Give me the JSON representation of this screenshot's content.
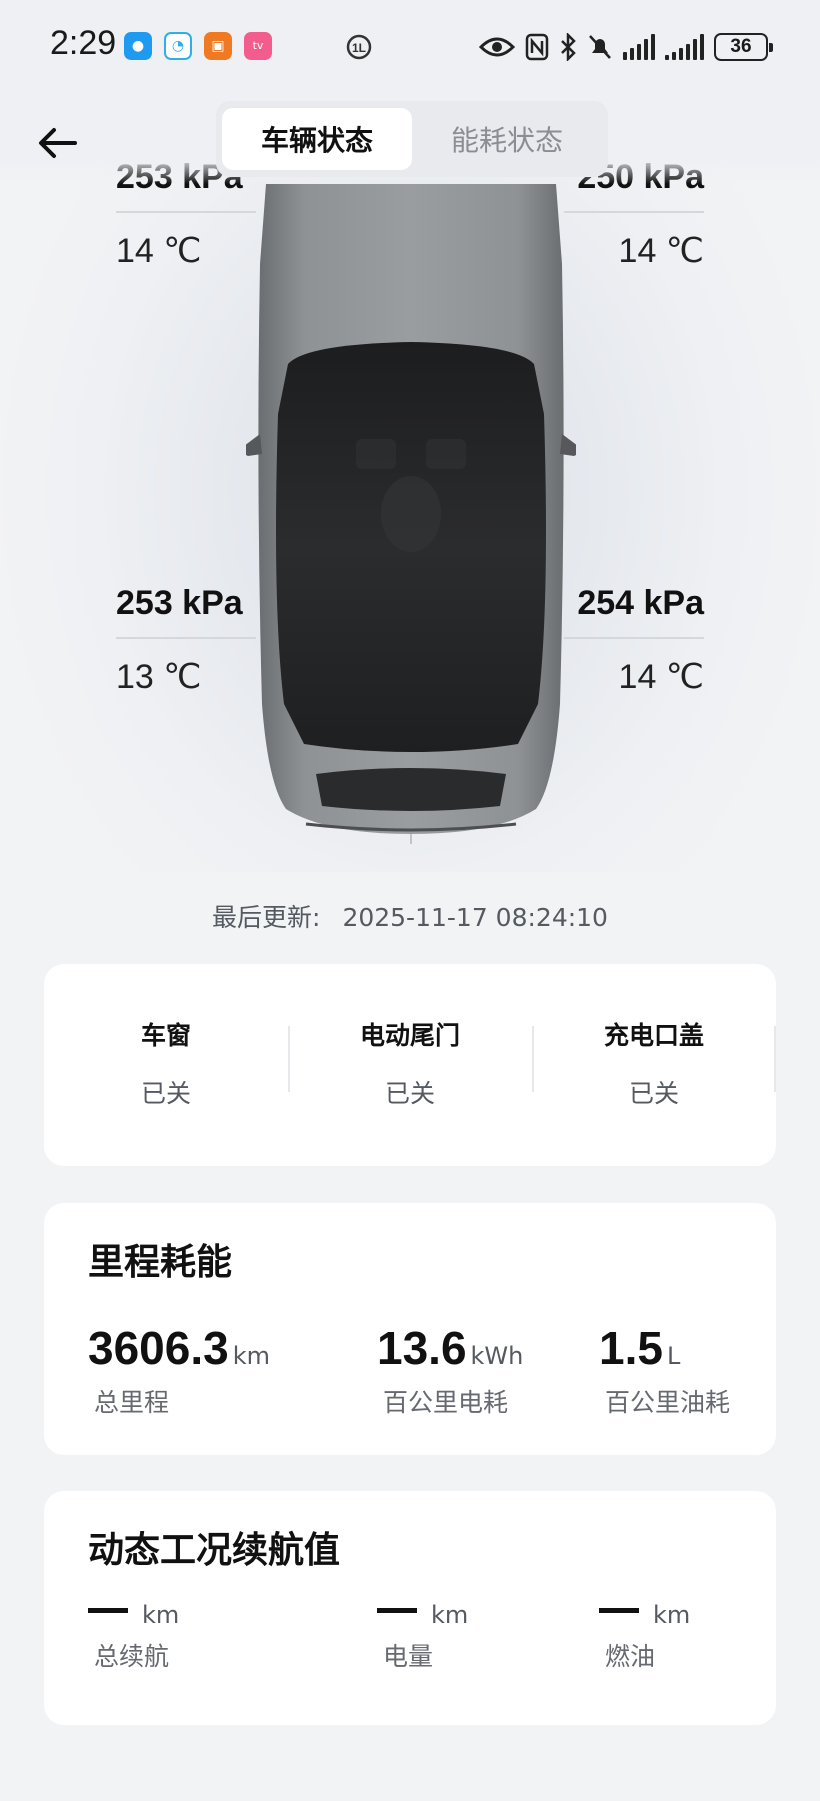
{
  "status_bar": {
    "time": "2:29",
    "battery": "36",
    "icons": [
      "message-app-icon",
      "chat-app-icon",
      "orange-app-icon",
      "bilibili-app-icon",
      "sync-icon",
      "eye-icon",
      "nfc-icon",
      "bluetooth-icon",
      "mute-icon",
      "signal-icon",
      "signal-icon",
      "battery-icon"
    ]
  },
  "header": {
    "tabs": [
      {
        "label": "车辆状态",
        "active": true
      },
      {
        "label": "能耗状态",
        "active": false
      }
    ]
  },
  "tires": {
    "front_left": {
      "pressure": "253 kPa",
      "temp": "14 ℃"
    },
    "front_right": {
      "pressure": "250 kPa",
      "temp": "14 ℃"
    },
    "rear_left": {
      "pressure": "253 kPa",
      "temp": "13 ℃"
    },
    "rear_right": {
      "pressure": "254 kPa",
      "temp": "14 ℃"
    }
  },
  "last_updated": {
    "label": "最后更新:",
    "value": "2025-11-17 08:24:10"
  },
  "closures": [
    {
      "title": "车窗",
      "value": "已关"
    },
    {
      "title": "电动尾门",
      "value": "已关"
    },
    {
      "title": "充电口盖",
      "value": "已关"
    }
  ],
  "mileage": {
    "title": "里程耗能",
    "items": [
      {
        "value": "3606.3",
        "unit": "km",
        "label": "总里程"
      },
      {
        "value": "13.6",
        "unit": "kWh",
        "label": "百公里电耗"
      },
      {
        "value": "1.5",
        "unit": "L",
        "label": "百公里油耗"
      }
    ]
  },
  "range": {
    "title": "动态工况续航值",
    "items": [
      {
        "unit": "km",
        "label": "总续航"
      },
      {
        "unit": "km",
        "label": "电量"
      },
      {
        "unit": "km",
        "label": "燃油"
      }
    ]
  },
  "colors": {
    "background": "#f2f3f5",
    "card": "#ffffff",
    "text_primary": "#111111",
    "text_secondary": "#555a61"
  }
}
